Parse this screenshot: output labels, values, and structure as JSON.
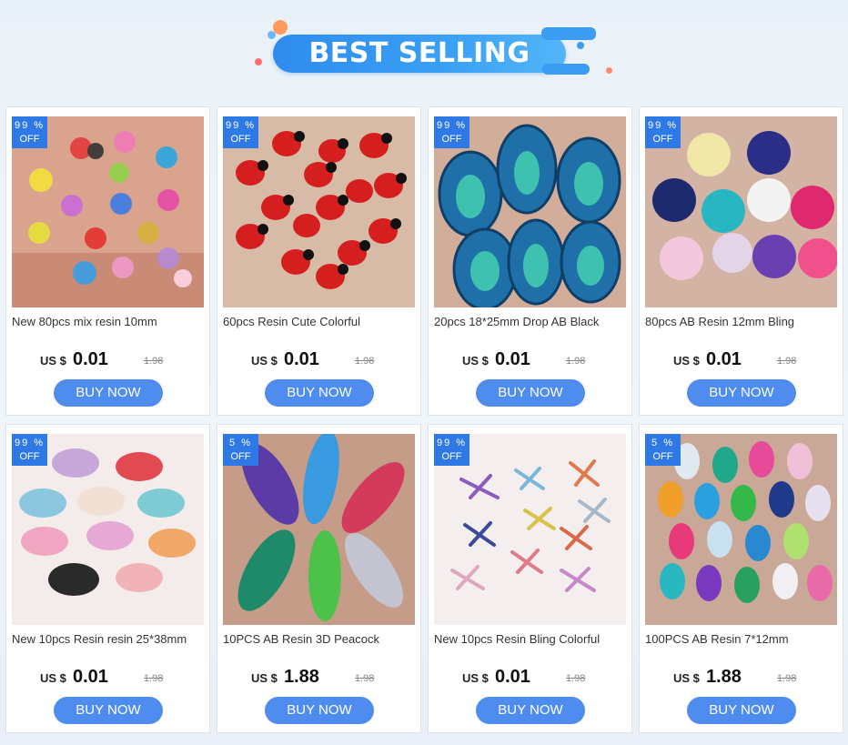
{
  "header": {
    "title": "BEST SELLING"
  },
  "colors": {
    "accent": "#3b9cf2",
    "button": "#4f8cf0",
    "badge": "#2e79e6"
  },
  "products": [
    {
      "badge_pct": "99 %",
      "badge_off": "OFF",
      "name": "New 80pcs mix resin 10mm",
      "currency": "US $",
      "price": "0.01",
      "old_price": "1.98",
      "button": "BUY NOW",
      "image": "butterflies-icon"
    },
    {
      "badge_pct": "99 %",
      "badge_off": "OFF",
      "name": "60pcs Resin Cute Colorful",
      "currency": "US $",
      "price": "0.01",
      "old_price": "1.98",
      "button": "BUY NOW",
      "image": "ladybugs-icon"
    },
    {
      "badge_pct": "99 %",
      "badge_off": "OFF",
      "name": "20pcs 18*25mm Drop AB Black",
      "currency": "US $",
      "price": "0.01",
      "old_price": "1.98",
      "button": "BUY NOW",
      "image": "teardrops-icon"
    },
    {
      "badge_pct": "99 %",
      "badge_off": "OFF",
      "name": "80pcs AB Resin 12mm Bling",
      "currency": "US $",
      "price": "0.01",
      "old_price": "1.98",
      "button": "BUY NOW",
      "image": "hearts-icon"
    },
    {
      "badge_pct": "99 %",
      "badge_off": "OFF",
      "name": "New 10pcs Resin resin 25*38mm",
      "currency": "US $",
      "price": "0.01",
      "old_price": "1.98",
      "button": "BUY NOW",
      "image": "butterfly-charms-icon"
    },
    {
      "badge_pct": "5 %",
      "badge_off": "OFF",
      "name": "10PCS  AB Resin 3D Peacock",
      "currency": "US $",
      "price": "1.88",
      "old_price": "1.98",
      "button": "BUY NOW",
      "image": "peacock-feathers-icon"
    },
    {
      "badge_pct": "99 %",
      "badge_off": "OFF",
      "name": "New 10pcs Resin Bling Colorful",
      "currency": "US $",
      "price": "0.01",
      "old_price": "1.98",
      "button": "BUY NOW",
      "image": "dragonflies-icon"
    },
    {
      "badge_pct": "5 %",
      "badge_off": "OFF",
      "name": "100PCS AB Resin 7*12mm",
      "currency": "US $",
      "price": "1.88",
      "old_price": "1.98",
      "button": "BUY NOW",
      "image": "mixed-drops-icon"
    }
  ]
}
